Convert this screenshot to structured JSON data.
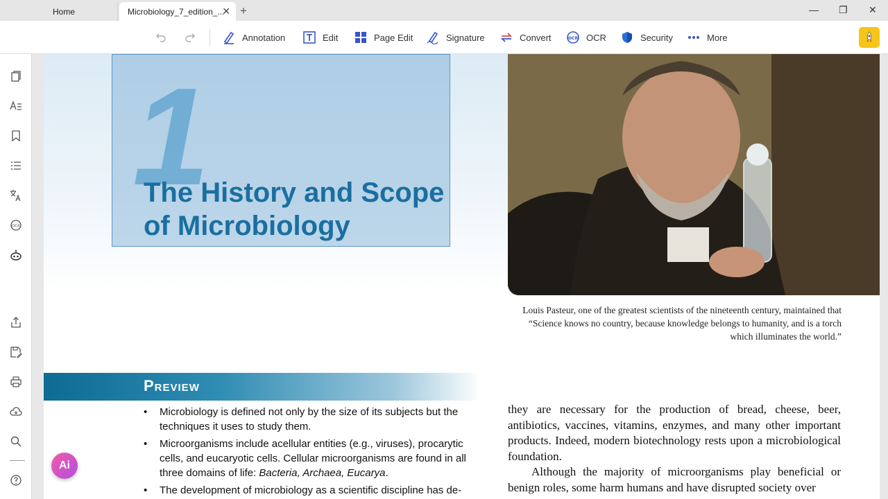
{
  "tabs": {
    "home_label": "Home",
    "doc_label": "Microbiology_7_edition_...",
    "close_glyph": "✕",
    "new_tab_glyph": "+"
  },
  "window": {
    "minimize": "—",
    "restore": "❐",
    "close": "✕"
  },
  "toolbar": {
    "annotation": "Annotation",
    "edit": "Edit",
    "page_edit": "Page Edit",
    "signature": "Signature",
    "convert": "Convert",
    "ocr": "OCR",
    "security": "Security",
    "more": "More"
  },
  "colors": {
    "accent": "#1a6fa0",
    "preview_bar": "#0d6b94",
    "ai_button": "#d955c4"
  },
  "document": {
    "chapter_number": "1",
    "chapter_title": "The History and Scope of Microbiology",
    "caption": "Louis Pasteur, one of the greatest scientists of the nineteenth century, maintained that “Science knows no country, because knowledge belongs to humanity, and is a torch which illuminates the world.”",
    "preview_heading": "Preview",
    "bullets": [
      "Microbiology is defined not only by the size of its subjects but the techniques it uses to study them.",
      "Microorganisms include acellular entities (e.g., viruses), procarytic cells, and eucaryotic cells. Cellular microorganisms are found in all three domains of life: ",
      "The development of microbiology as a scientific discipline has de-"
    ],
    "bullet_2_italic": "Bacteria, Archaea, Eucarya",
    "bullet_2_end": ".",
    "body_p1": "they are necessary for the production of bread, cheese, beer, antibiotics, vaccines, vitamins, enzymes, and many other important products. Indeed, modern biotechnology rests upon a microbiological foundation.",
    "body_p2": "Although the majority of microorganisms play beneficial or benign roles, some harm humans and have disrupted society over"
  },
  "ai_button": {
    "label": "Ai"
  }
}
